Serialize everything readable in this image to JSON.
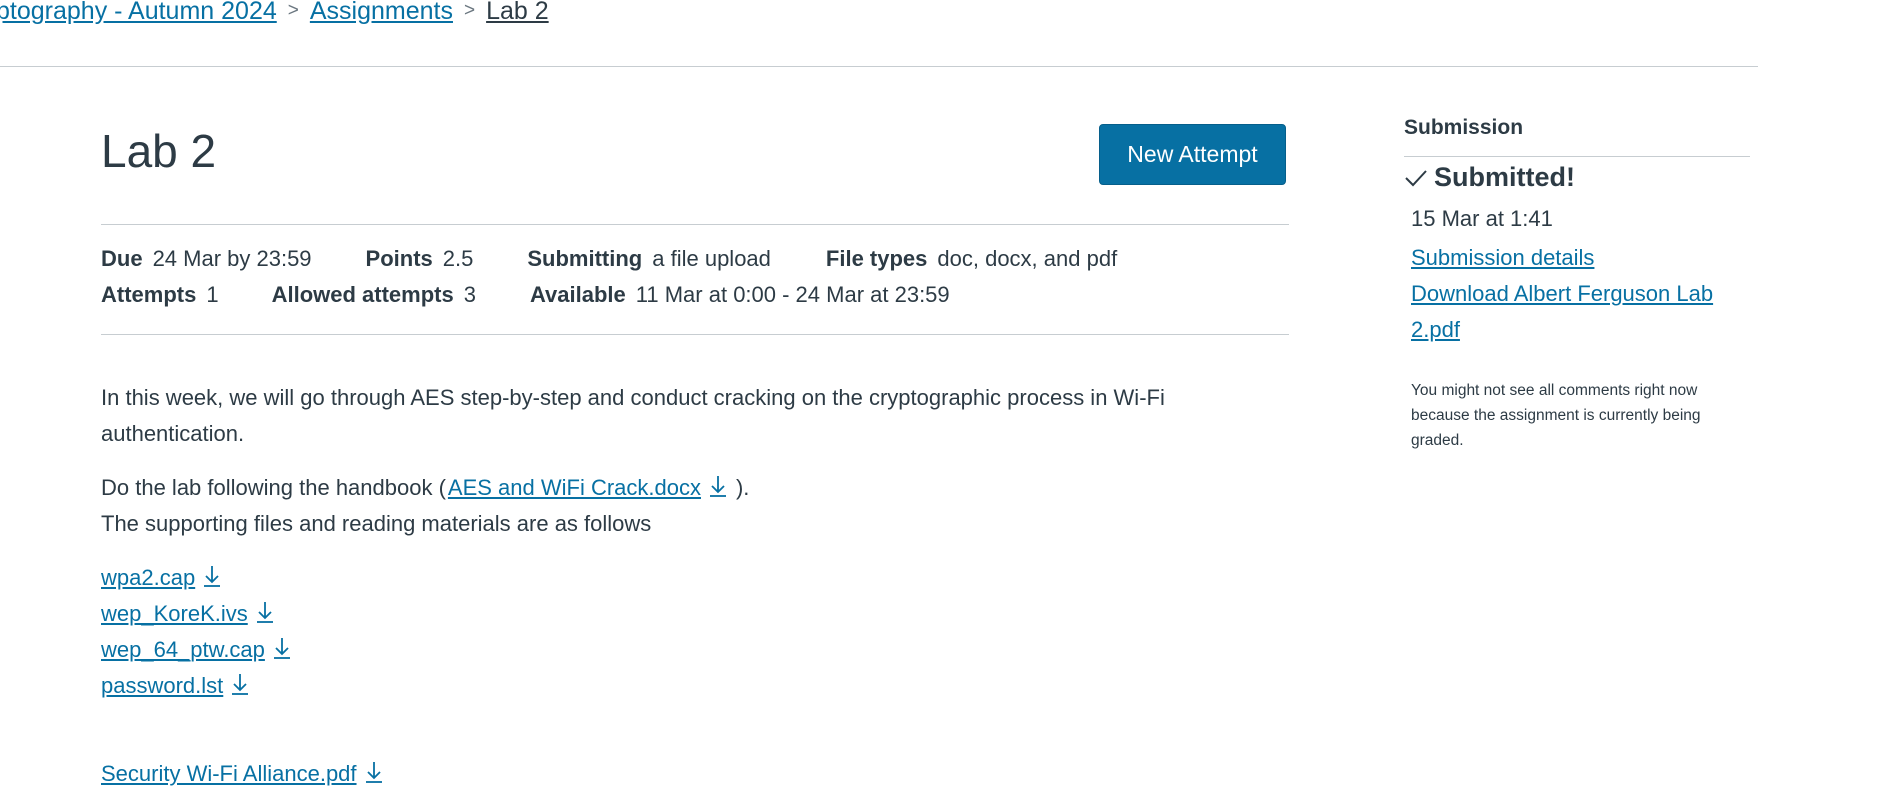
{
  "breadcrumb": {
    "course": "ptography - Autumn 2024",
    "separator": ">",
    "assignments": "Assignments",
    "current": "Lab 2"
  },
  "assignment": {
    "title": "Lab 2",
    "new_attempt_label": "New Attempt",
    "details": {
      "due_label": "Due",
      "due_value": "24 Mar by 23:59",
      "points_label": "Points",
      "points_value": "2.5",
      "submitting_label": "Submitting",
      "submitting_value": "a file upload",
      "filetypes_label": "File types",
      "filetypes_value": "doc, docx, and pdf",
      "attempts_label": "Attempts",
      "attempts_value": "1",
      "allowed_label": "Allowed attempts",
      "allowed_value": "3",
      "available_label": "Available",
      "available_value": "11 Mar at 0:00 - 24 Mar at 23:59"
    },
    "description": {
      "intro": "In this week, we will go through AES step-by-step and conduct cracking on the cryptographic process in Wi-Fi authentication.",
      "handbook_prefix": "Do the lab following the handbook (",
      "handbook_link": "AES and WiFi Crack.docx",
      "handbook_suffix": ").",
      "supporting": "The supporting files and reading materials are as follows"
    },
    "files": [
      "wpa2.cap",
      "wep_KoreK.ivs",
      "wep_64_ptw.cap",
      "password.lst",
      "Security Wi-Fi Alliance.pdf"
    ]
  },
  "submission": {
    "heading": "Submission",
    "status": "Submitted!",
    "date": "15 Mar at 1:41",
    "details_link": "Submission details",
    "download_link": "Download Albert Ferguson Lab 2.pdf",
    "note": "You might not see all comments right now because the assignment is currently being graded."
  },
  "colors": {
    "link": "#0770a3",
    "button_bg": "#0770a3",
    "text": "#2d3b45",
    "rule": "#c7cdd1"
  },
  "icons": {
    "download": "download-arrow-icon",
    "check": "check-icon"
  }
}
